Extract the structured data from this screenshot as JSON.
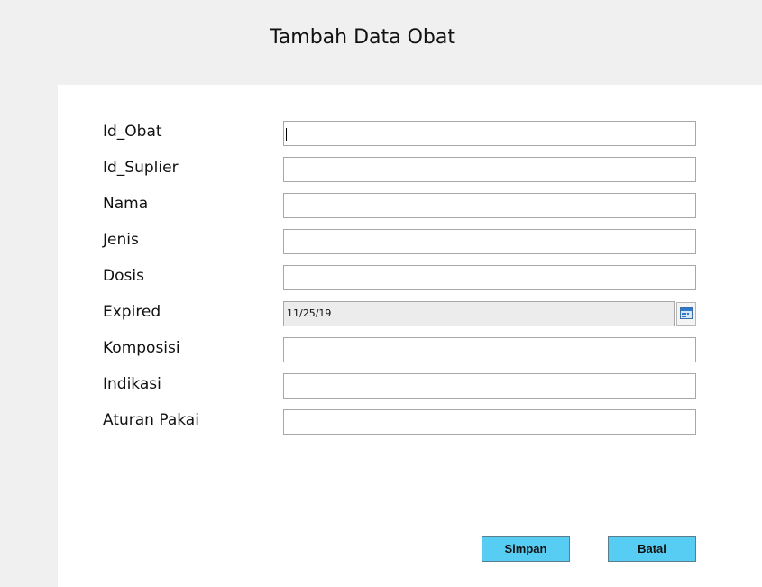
{
  "header": {
    "title": "Tambah Data Obat"
  },
  "form": {
    "fields": [
      {
        "label": "Id_Obat",
        "value": ""
      },
      {
        "label": "Id_Suplier",
        "value": ""
      },
      {
        "label": "Nama",
        "value": ""
      },
      {
        "label": "Jenis",
        "value": ""
      },
      {
        "label": "Dosis",
        "value": ""
      },
      {
        "label": "Expired",
        "value": "11/25/19"
      },
      {
        "label": "Komposisi",
        "value": ""
      },
      {
        "label": "Indikasi",
        "value": ""
      },
      {
        "label": "Aturan Pakai",
        "value": ""
      }
    ],
    "date_picker_icon": "calendar-icon"
  },
  "actions": {
    "save_label": "Simpan",
    "cancel_label": "Batal",
    "button_color": "#58cdf3"
  }
}
